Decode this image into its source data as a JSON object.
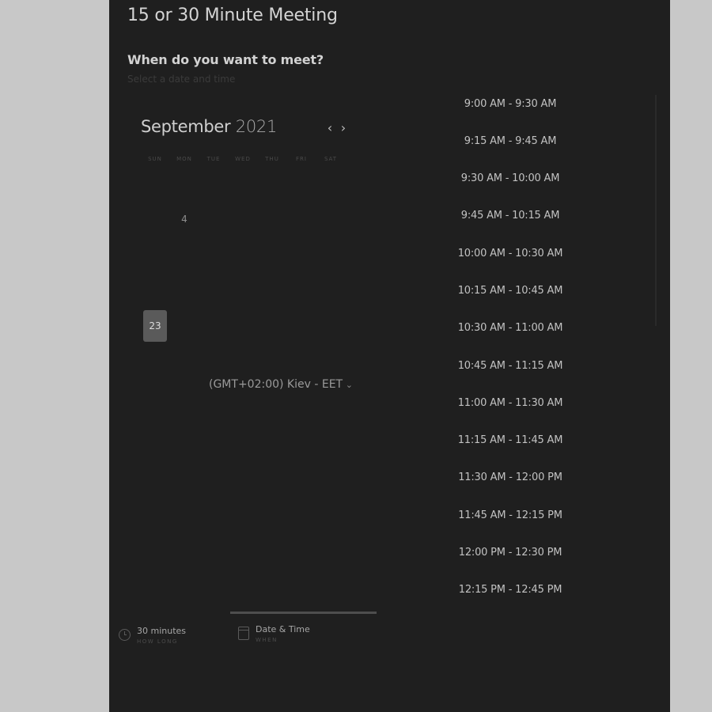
{
  "event": {
    "title": "15 or 30 Minute Meeting"
  },
  "scheduler": {
    "question": "When do you want to meet?",
    "hint": "Select a date and time"
  },
  "calendar": {
    "month": "September",
    "year": "2021",
    "prev_icon": "chevron-left-icon",
    "next_icon": "chevron-right-icon",
    "weekdays": [
      "SUN",
      "MON",
      "TUE",
      "WED",
      "THU",
      "FRI",
      "SAT"
    ],
    "visible_days": [
      "4",
      "23"
    ],
    "selected_available_day": "23"
  },
  "timezone": {
    "label": "(GMT+02:00) Kiev - EET",
    "icon": "chevron-down-icon"
  },
  "slots": [
    "9:00 AM - 9:30 AM",
    "9:15 AM - 9:45 AM",
    "9:30 AM - 10:00 AM",
    "9:45 AM - 10:15 AM",
    "10:00 AM - 10:30 AM",
    "10:15 AM - 10:45 AM",
    "10:30 AM - 11:00 AM",
    "10:45 AM - 11:15 AM",
    "11:00 AM - 11:30 AM",
    "11:15 AM - 11:45 AM",
    "11:30 AM - 12:00 PM",
    "11:45 AM - 12:15 PM",
    "12:00 PM - 12:30 PM",
    "12:15 PM - 12:45 PM"
  ],
  "steps": {
    "duration": {
      "value": "30 minutes",
      "caption": "HOW LONG",
      "icon": "clock-icon"
    },
    "datetime": {
      "value": "Date & Time",
      "caption": "WHEN",
      "icon": "calendar-icon"
    }
  },
  "colors": {
    "background": "#c8c8c8",
    "panel": "#1f1f1f",
    "available_day": "#5a5a5a"
  }
}
